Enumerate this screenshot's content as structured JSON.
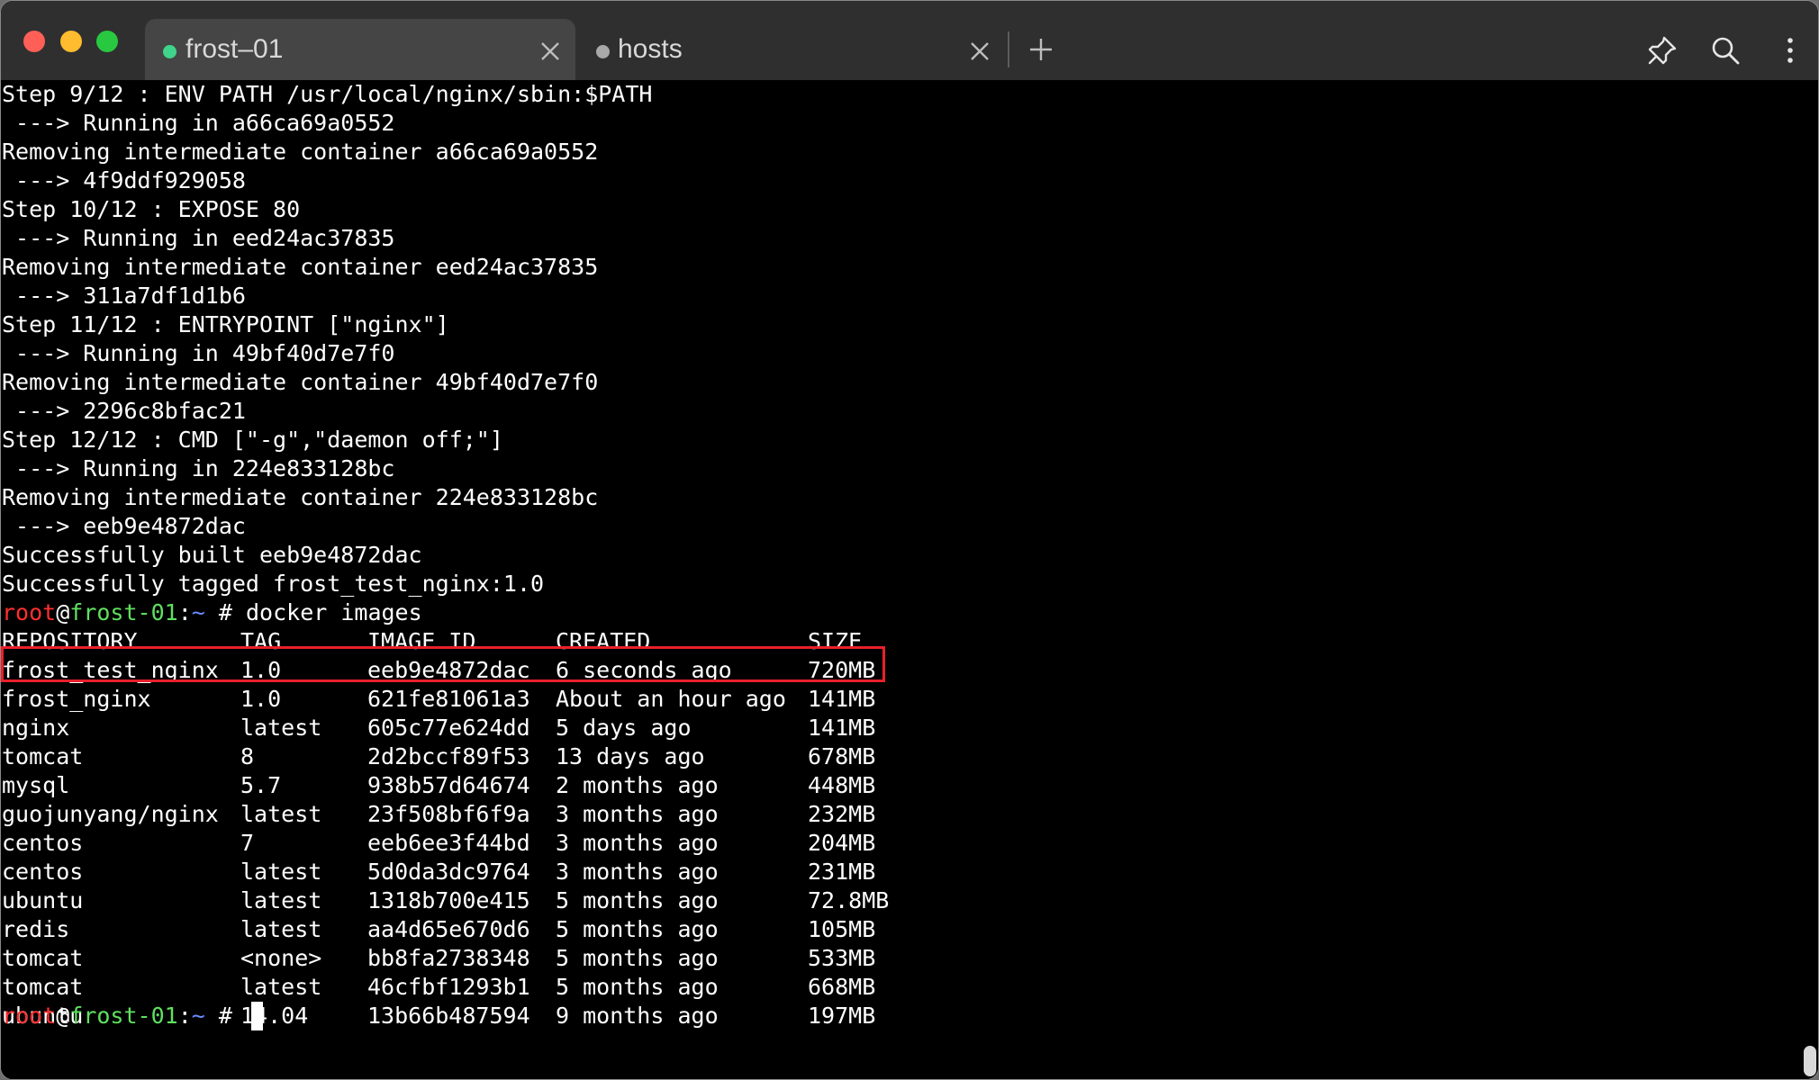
{
  "tabs": [
    {
      "label": "frost–01",
      "active": true,
      "dot_color": "#40d48a"
    },
    {
      "label": "hosts",
      "active": false,
      "dot_color": "#a8a8a8"
    }
  ],
  "terminal": {
    "build_lines": [
      "Step 9/12 : ENV PATH /usr/local/nginx/sbin:$PATH",
      " ---> Running in a66ca69a0552",
      "Removing intermediate container a66ca69a0552",
      " ---> 4f9ddf929058",
      "Step 10/12 : EXPOSE 80",
      " ---> Running in eed24ac37835",
      "Removing intermediate container eed24ac37835",
      " ---> 311a7df1d1b6",
      "Step 11/12 : ENTRYPOINT [\"nginx\"]",
      " ---> Running in 49bf40d7e7f0",
      "Removing intermediate container 49bf40d7e7f0",
      " ---> 2296c8bfac21",
      "Step 12/12 : CMD [\"-g\",\"daemon off;\"]",
      " ---> Running in 224e833128bc",
      "Removing intermediate container 224e833128bc",
      " ---> eeb9e4872dac",
      "Successfully built eeb9e4872dac",
      "Successfully tagged frost_test_nginx:1.0"
    ],
    "prompt": {
      "user": "root",
      "at": "@",
      "host": "frost-01",
      "colon": ":",
      "path": "~",
      "symbol": " # "
    },
    "command": "docker images",
    "table": {
      "headers": [
        "REPOSITORY",
        "TAG",
        "IMAGE ID",
        "CREATED",
        "SIZE"
      ],
      "rows": [
        [
          "frost_test_nginx",
          "1.0",
          "eeb9e4872dac",
          "6 seconds ago",
          "720MB"
        ],
        [
          "frost_nginx",
          "1.0",
          "621fe81061a3",
          "About an hour ago",
          "141MB"
        ],
        [
          "nginx",
          "latest",
          "605c77e624dd",
          "5 days ago",
          "141MB"
        ],
        [
          "tomcat",
          "8",
          "2d2bccf89f53",
          "13 days ago",
          "678MB"
        ],
        [
          "mysql",
          "5.7",
          "938b57d64674",
          "2 months ago",
          "448MB"
        ],
        [
          "guojunyang/nginx",
          "latest",
          "23f508bf6f9a",
          "3 months ago",
          "232MB"
        ],
        [
          "centos",
          "7",
          "eeb6ee3f44bd",
          "3 months ago",
          "204MB"
        ],
        [
          "centos",
          "latest",
          "5d0da3dc9764",
          "3 months ago",
          "231MB"
        ],
        [
          "ubuntu",
          "latest",
          "1318b700e415",
          "5 months ago",
          "72.8MB"
        ],
        [
          "redis",
          "latest",
          "aa4d65e670d6",
          "5 months ago",
          "105MB"
        ],
        [
          "tomcat",
          "<none>",
          "bb8fa2738348",
          "5 months ago",
          "533MB"
        ],
        [
          "tomcat",
          "latest",
          "46cfbf1293b1",
          "5 months ago",
          "668MB"
        ],
        [
          "ubuntu",
          "14.04",
          "13b66b487594",
          "9 months ago",
          "197MB"
        ]
      ]
    },
    "colors": {
      "prompt_user": "#ff2f2f",
      "prompt_host": "#5fe05f",
      "prompt_path": "#6a8cff",
      "highlight_box": "#e8202a"
    }
  }
}
